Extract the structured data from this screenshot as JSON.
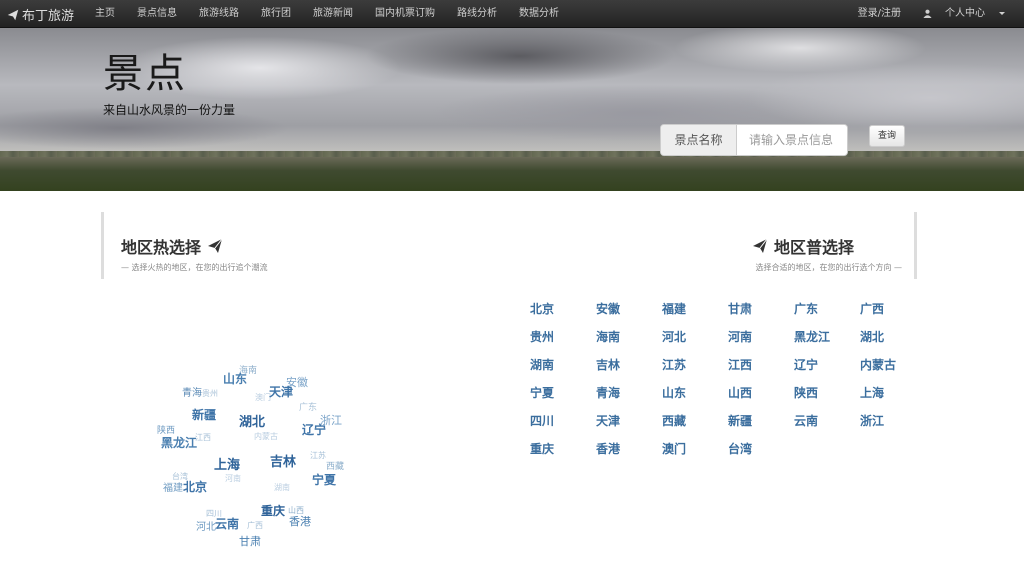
{
  "navbar": {
    "brand": "布丁旅游",
    "brand_icon": "paper-plane-icon",
    "links": [
      "主页",
      "景点信息",
      "旅游线路",
      "旅行团",
      "旅游新闻",
      "国内机票订购",
      "路线分析",
      "数据分析"
    ],
    "login": "登录/注册",
    "user_center": "个人中心"
  },
  "hero": {
    "title": "景点",
    "subtitle": "来自山水风景的一份力量",
    "search_label": "景点名称",
    "search_placeholder": "请输入景点信息",
    "search_button": "查询"
  },
  "hot_section": {
    "title": "地区热选择",
    "subtitle": "— 选择火热的地区，在您的出行追个潮流"
  },
  "common_section": {
    "title": "地区普选择",
    "subtitle": "选择合适的地区，在您的出行选个方向 —"
  },
  "regions": [
    "北京",
    "安徽",
    "福建",
    "甘肃",
    "广东",
    "广西",
    "贵州",
    "海南",
    "河北",
    "河南",
    "黑龙江",
    "湖北",
    "湖南",
    "吉林",
    "江苏",
    "江西",
    "辽宁",
    "内蒙古",
    "宁夏",
    "青海",
    "山东",
    "山西",
    "陕西",
    "上海",
    "四川",
    "天津",
    "西藏",
    "新疆",
    "云南",
    "浙江",
    "重庆",
    "香港",
    "澳门",
    "台湾"
  ],
  "word_cloud": [
    {
      "text": "海南",
      "color": "#8fb0cc"
    },
    {
      "text": "山东",
      "color": "#4a7fb0"
    },
    {
      "text": "安徽",
      "color": "#7aa3c8"
    },
    {
      "text": "青海",
      "color": "#5b8ab5"
    },
    {
      "text": "贵州",
      "color": "#a9c2d8"
    },
    {
      "text": "澳门",
      "color": "#b9cde0"
    },
    {
      "text": "天津",
      "color": "#3f74a8"
    },
    {
      "text": "广东",
      "color": "#a9c2d8"
    },
    {
      "text": "新疆",
      "color": "#3f74a8"
    },
    {
      "text": "浙江",
      "color": "#7aa3c8"
    },
    {
      "text": "湖北",
      "color": "#2f6399"
    },
    {
      "text": "辽宁",
      "color": "#3f74a8"
    },
    {
      "text": "陕西",
      "color": "#6f9bc2"
    },
    {
      "text": "江西",
      "color": "#a9c2d8"
    },
    {
      "text": "内蒙古",
      "color": "#b9cde0"
    },
    {
      "text": "黑龙江",
      "color": "#4a7fb0"
    },
    {
      "text": "江苏",
      "color": "#a9c2d8"
    },
    {
      "text": "上海",
      "color": "#2f6399"
    },
    {
      "text": "吉林",
      "color": "#2f6399"
    },
    {
      "text": "西藏",
      "color": "#8fb0cc"
    },
    {
      "text": "台湾",
      "color": "#a9c2d8"
    },
    {
      "text": "河南",
      "color": "#b9cde0"
    },
    {
      "text": "宁夏",
      "color": "#3f74a8"
    },
    {
      "text": "福建",
      "color": "#6f9bc2"
    },
    {
      "text": "北京",
      "color": "#3f74a8"
    },
    {
      "text": "湖南",
      "color": "#b9cde0"
    },
    {
      "text": "重庆",
      "color": "#2f6399"
    },
    {
      "text": "四川",
      "color": "#a9c2d8"
    },
    {
      "text": "山西",
      "color": "#8fb0cc"
    },
    {
      "text": "云南",
      "color": "#3f74a8"
    },
    {
      "text": "香港",
      "color": "#4a7fb0"
    },
    {
      "text": "河北",
      "color": "#6f9bc2"
    },
    {
      "text": "广西",
      "color": "#a9c2d8"
    },
    {
      "text": "甘肃",
      "color": "#4a7fb0"
    }
  ],
  "colors": {
    "navbar": "#2b2b2b",
    "region_link": "#3b6e9e"
  }
}
